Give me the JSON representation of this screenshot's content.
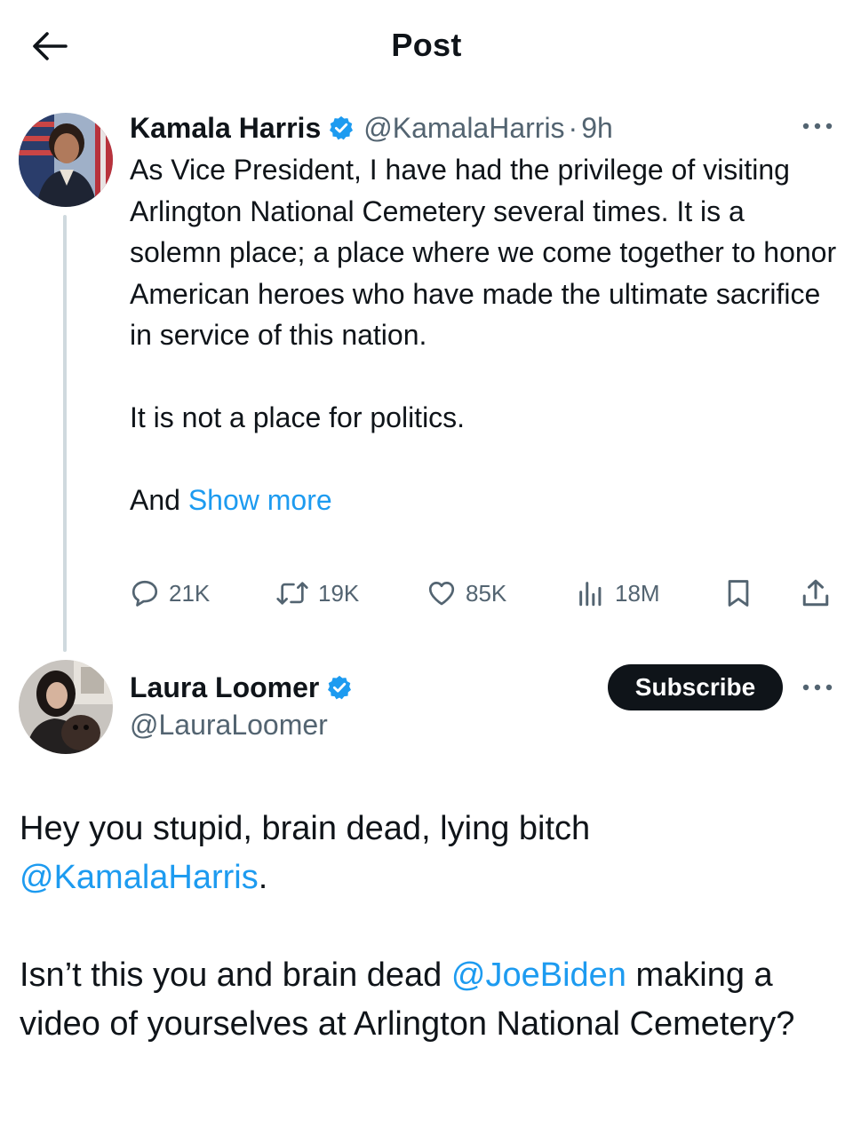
{
  "header": {
    "title": "Post",
    "back_icon": "arrow-left-icon"
  },
  "tweet1": {
    "author_name": "Kamala Harris",
    "author_handle": "@KamalaHarris",
    "separator": "·",
    "time": "9h",
    "verified": true,
    "paragraphs": [
      "As Vice President, I have had the privilege of visiting Arlington National Cemetery several times. It is a solemn place; a place where we come together to honor American heroes who have made the ultimate sacrifice in service of this nation.",
      "It is not a place for politics."
    ],
    "truncated_text": "And",
    "show_more": "Show more",
    "stats": {
      "replies": "21K",
      "reposts": "19K",
      "likes": "85K",
      "views": "18M"
    }
  },
  "tweet2": {
    "author_name": "Laura Loomer",
    "author_handle": "@LauraLoomer",
    "verified": true,
    "subscribe_label": "Subscribe",
    "paragraph1_text": "Hey you stupid, brain dead, lying bitch",
    "paragraph1_mention": "@KamalaHarris",
    "paragraph1_end": ".",
    "paragraph2_before": "Isn’t this you and brain dead",
    "paragraph2_mention": "@JoeBiden",
    "paragraph2_after": "making a video of yourselves at Arlington National Cemetery?"
  },
  "colors": {
    "text": "#0f1419",
    "secondary": "#536471",
    "link": "#1d9bf0",
    "verified": "#1d9bf0",
    "thread_line": "#cfd9de",
    "button_bg": "#0f1419"
  }
}
